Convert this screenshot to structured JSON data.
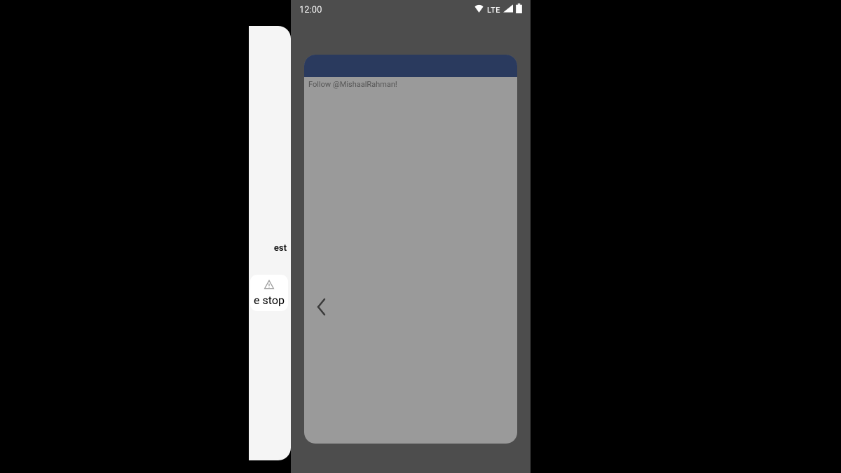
{
  "status": {
    "time": "12:00",
    "network_type": "LTE"
  },
  "app_card": {
    "follow_text": "Follow @MishaalRahman!"
  },
  "prev_panel": {
    "text_fragment": "est",
    "stop_label": "e stop"
  }
}
